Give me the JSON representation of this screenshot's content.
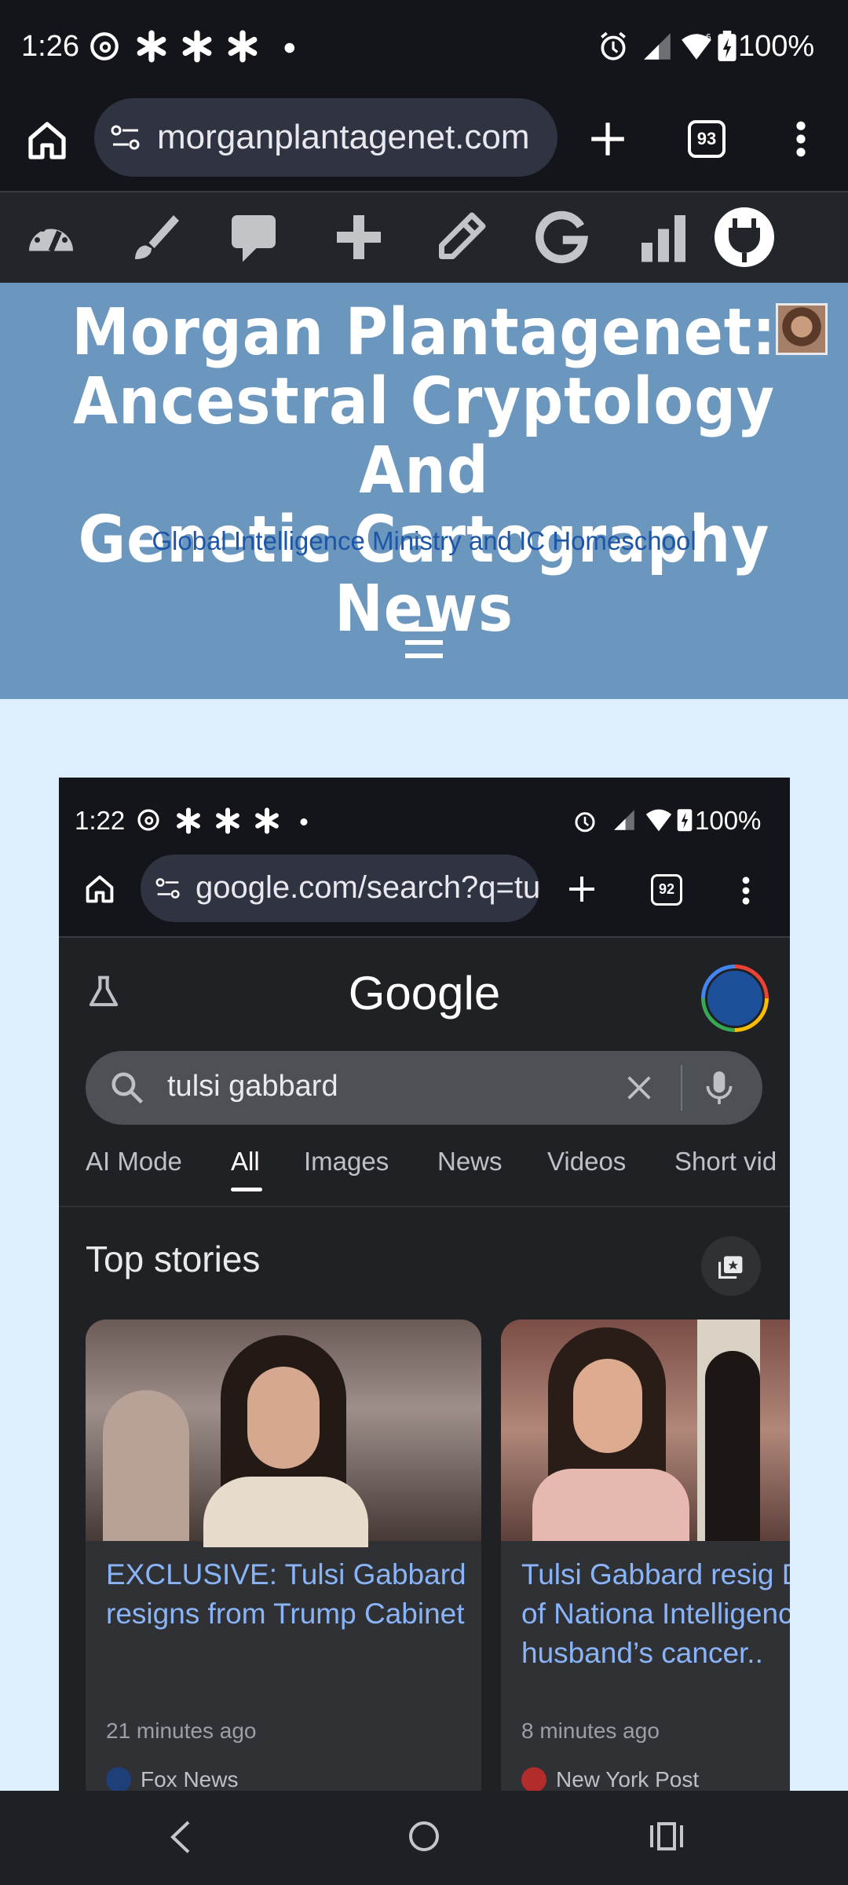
{
  "status_bar": {
    "time": "1:26",
    "battery": "100%"
  },
  "browser": {
    "url": "morganplantagenet.com",
    "tab_count": "93"
  },
  "site": {
    "title_line1": "Morgan Plantagenet:",
    "title_line2": "Ancestral Cryptology And",
    "title_line3": "Genetic Cartography News",
    "tagline": "Global Intelligence Ministry and IC Homeschool"
  },
  "embedded": {
    "status_time": "1:22",
    "battery": "100%",
    "url": "google.com/search?q=tu",
    "tab_count": "92",
    "google_logo": "Google",
    "search_query": "tulsi gabbard",
    "tabs": [
      "AI Mode",
      "All",
      "Images",
      "News",
      "Videos",
      "Short vid"
    ],
    "section_title": "Top stories",
    "stories": [
      {
        "headline": "EXCLUSIVE: Tulsi Gabbard resigns from Trump Cabinet",
        "age": "21 minutes ago",
        "source": "Fox News"
      },
      {
        "headline": "Tulsi Gabbard resig Director of Nationa Intelligence, citing husband’s cancer..",
        "age": "8 minutes ago",
        "source": "New York Post"
      }
    ]
  },
  "colors": {
    "header_bg": "#6b96be",
    "page_bg": "#ddeffd",
    "link_blue": "#8ab4f8",
    "tagline_blue": "#1d56a6"
  }
}
